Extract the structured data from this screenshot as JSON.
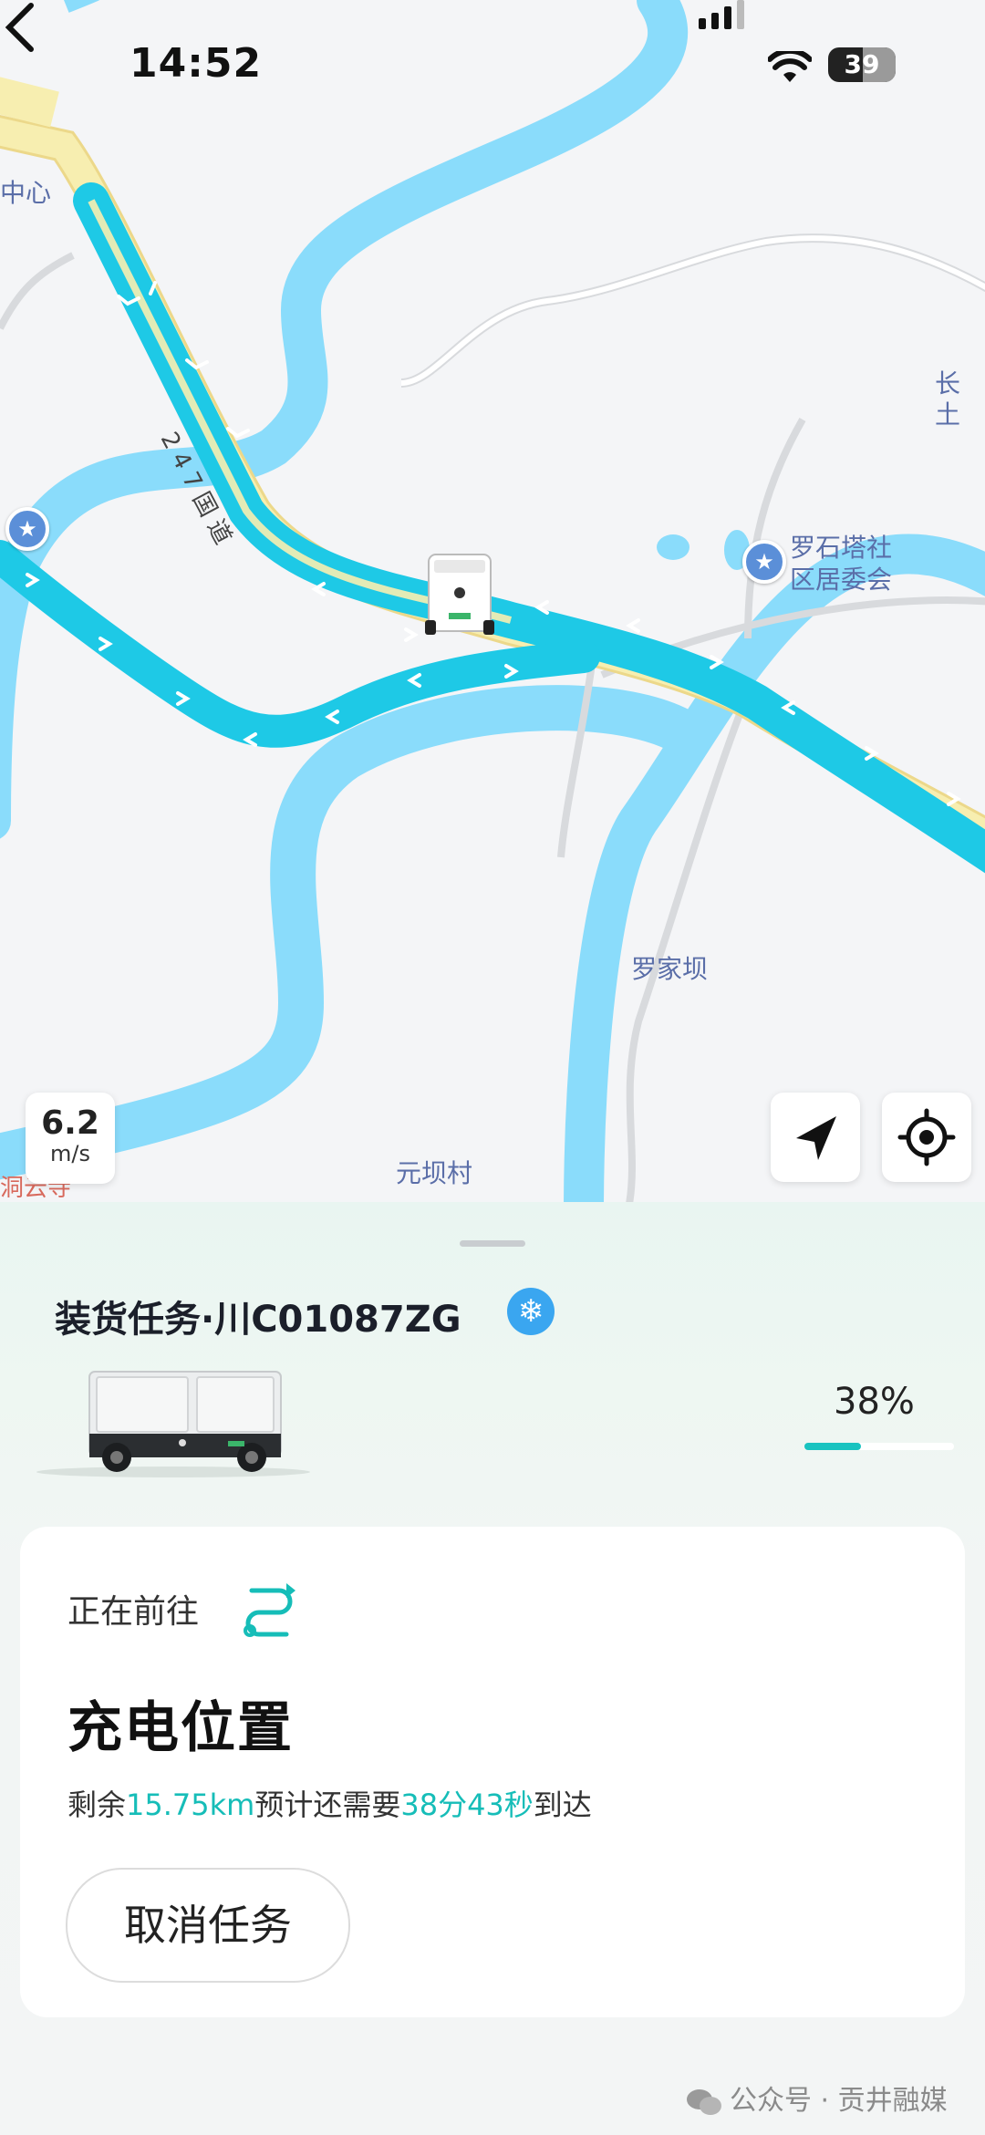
{
  "status_bar": {
    "time": "14:52",
    "battery": "39"
  },
  "map": {
    "places": [
      "中心",
      "长土",
      "罗石塔社",
      "区居委会",
      "罗家坝",
      "元坝村",
      "洞云寺"
    ],
    "road_label": "2 4 7 国 道",
    "speed": {
      "value": "6.2",
      "unit": "m/s"
    }
  },
  "task": {
    "title": "装货任务·川C01087ZG",
    "battery_percent_text": "38%",
    "battery_percent": 38
  },
  "card": {
    "going_label": "正在前往",
    "destination": "充电位置",
    "eta": {
      "prefix": "剩余",
      "distance": "15.75km",
      "middle": "预计还需要",
      "duration": "38分43秒",
      "suffix": "到达"
    },
    "cancel_label": "取消任务"
  },
  "watermark": "公众号 · 贡井融媒",
  "colors": {
    "accent": "#16bdb8",
    "route": "#1ec9e6",
    "river": "#8adcfb",
    "road": "#f7eeb0"
  }
}
